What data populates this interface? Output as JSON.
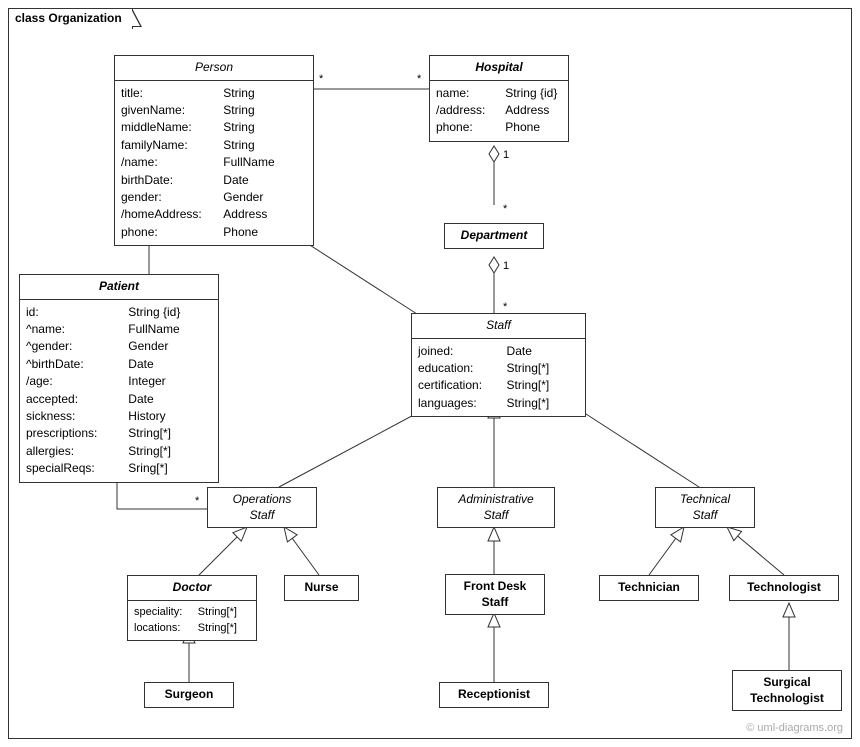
{
  "frame": {
    "title": "class Organization"
  },
  "classes": {
    "person": {
      "title": "Person",
      "attrs": [
        {
          "name": "title:",
          "type": "String"
        },
        {
          "name": "givenName:",
          "type": "String"
        },
        {
          "name": "middleName:",
          "type": "String"
        },
        {
          "name": "familyName:",
          "type": "String"
        },
        {
          "name": "/name:",
          "type": "FullName"
        },
        {
          "name": "birthDate:",
          "type": "Date"
        },
        {
          "name": "gender:",
          "type": "Gender"
        },
        {
          "name": "/homeAddress:",
          "type": "Address"
        },
        {
          "name": "phone:",
          "type": "Phone"
        }
      ]
    },
    "hospital": {
      "title": "Hospital",
      "attrs": [
        {
          "name": "name:",
          "type": "String {id}"
        },
        {
          "name": "/address:",
          "type": "Address"
        },
        {
          "name": "phone:",
          "type": "Phone"
        }
      ]
    },
    "department": {
      "title": "Department"
    },
    "patient": {
      "title": "Patient",
      "attrs": [
        {
          "name": "id:",
          "type": "String {id}"
        },
        {
          "name": "^name:",
          "type": "FullName"
        },
        {
          "name": "^gender:",
          "type": "Gender"
        },
        {
          "name": "^birthDate:",
          "type": "Date"
        },
        {
          "name": "/age:",
          "type": "Integer"
        },
        {
          "name": "accepted:",
          "type": "Date"
        },
        {
          "name": "sickness:",
          "type": "History"
        },
        {
          "name": "prescriptions:",
          "type": "String[*]"
        },
        {
          "name": "allergies:",
          "type": "String[*]"
        },
        {
          "name": "specialReqs:",
          "type": "Sring[*]"
        }
      ]
    },
    "staff": {
      "title": "Staff",
      "attrs": [
        {
          "name": "joined:",
          "type": "Date"
        },
        {
          "name": "education:",
          "type": "String[*]"
        },
        {
          "name": "certification:",
          "type": "String[*]"
        },
        {
          "name": "languages:",
          "type": "String[*]"
        }
      ]
    },
    "operations_staff": {
      "title": "Operations\nStaff"
    },
    "administrative_staff": {
      "title": "Administrative\nStaff"
    },
    "technical_staff": {
      "title": "Technical\nStaff"
    },
    "doctor": {
      "title": "Doctor",
      "attrs": [
        {
          "name": "speciality:",
          "type": "String[*]"
        },
        {
          "name": "locations:",
          "type": "String[*]"
        }
      ]
    },
    "nurse": {
      "title": "Nurse"
    },
    "front_desk_staff": {
      "title": "Front Desk\nStaff"
    },
    "technician": {
      "title": "Technician"
    },
    "technologist": {
      "title": "Technologist"
    },
    "surgeon": {
      "title": "Surgeon"
    },
    "receptionist": {
      "title": "Receptionist"
    },
    "surgical_technologist": {
      "title": "Surgical\nTechnologist"
    }
  },
  "multiplicities": {
    "person_hospital_left": "*",
    "person_hospital_right": "*",
    "hospital_dept_top": "1",
    "hospital_dept_bottom": "*",
    "dept_staff_top": "1",
    "dept_staff_bottom": "*",
    "patient_ops_left": "*",
    "patient_ops_right": "*"
  },
  "watermark": "© uml-diagrams.org"
}
